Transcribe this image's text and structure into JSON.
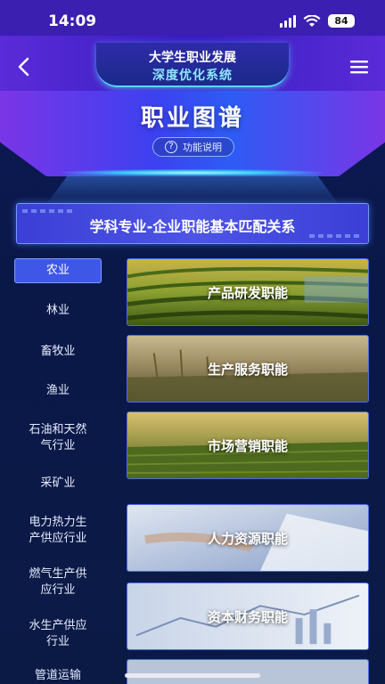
{
  "status_bar": {
    "time": "14:09",
    "battery": "84"
  },
  "header": {
    "title": "大学生职业发展",
    "subtitle": "深度优化系统"
  },
  "banner": {
    "title": "职业图谱",
    "help_label": "功能说明"
  },
  "section": {
    "title": "学科专业-企业职能基本匹配关系"
  },
  "categories": [
    {
      "label": "农业",
      "active": true
    },
    {
      "label": "林业"
    },
    {
      "label": "畜牧业"
    },
    {
      "label": "渔业"
    },
    {
      "label": "石油和天然\n气行业"
    },
    {
      "label": "采矿业"
    },
    {
      "label": "电力热力生\n产供应行业"
    },
    {
      "label": "燃气生产供\n应行业"
    },
    {
      "label": "水生产供应\n行业"
    },
    {
      "label": "管道运输"
    }
  ],
  "cards": [
    {
      "label": "产品研发职能"
    },
    {
      "label": "生产服务职能"
    },
    {
      "label": "市场营销职能"
    },
    {
      "label": "人力资源职能"
    },
    {
      "label": "资本财务职能"
    }
  ],
  "colors": {
    "accent": "#3f57e6",
    "header": "#3b1ec2",
    "glow": "#56d8ff"
  }
}
